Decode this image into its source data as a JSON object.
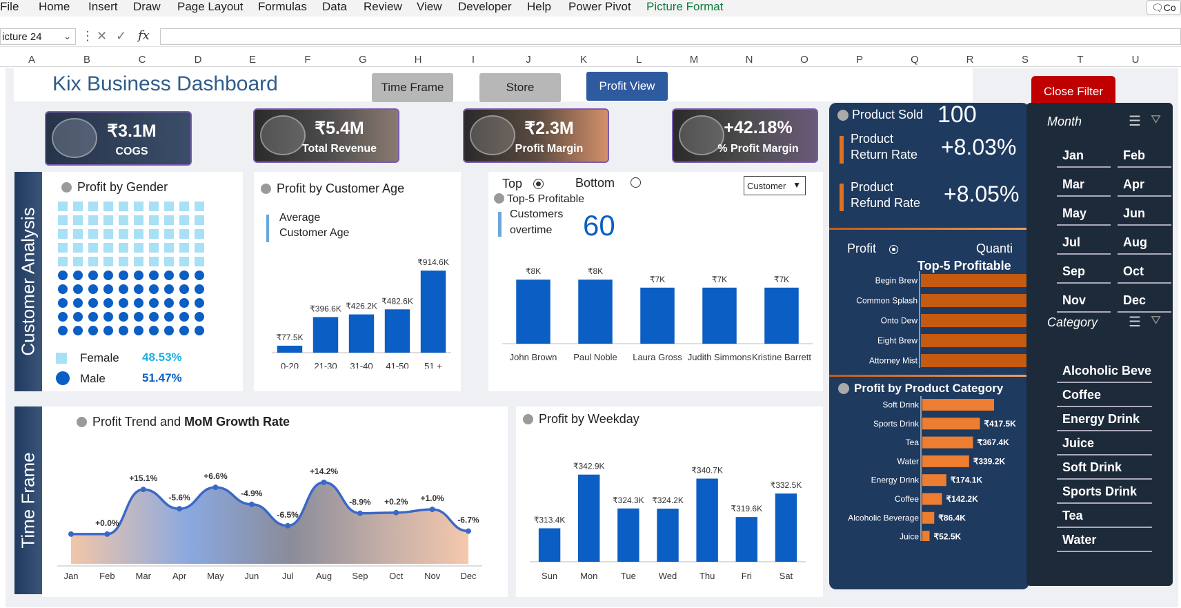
{
  "ribbon": {
    "tabs": [
      "File",
      "Home",
      "Insert",
      "Draw",
      "Page Layout",
      "Formulas",
      "Data",
      "Review",
      "View",
      "Developer",
      "Help",
      "Power Pivot",
      "Picture Format"
    ],
    "active": "Picture Format",
    "comments": "Co"
  },
  "formula_bar": {
    "name_box": "icture 24",
    "fx": "fx"
  },
  "columns": [
    "A",
    "B",
    "C",
    "D",
    "E",
    "F",
    "G",
    "H",
    "I",
    "J",
    "K",
    "L",
    "M",
    "N",
    "O",
    "P",
    "Q",
    "R",
    "S",
    "T",
    "U"
  ],
  "header": {
    "title": "Kix Business Dashboard",
    "buttons": [
      "Time Frame",
      "Store",
      "Profit View"
    ],
    "close": "Close Filter"
  },
  "kpis": [
    {
      "value": "₹3.1M",
      "label": "COGS"
    },
    {
      "value": "₹5.4M",
      "label": "Total Revenue"
    },
    {
      "value": "₹2.3M",
      "label": "Profit Margin"
    },
    {
      "value": "+42.18%",
      "label": "% Profit Margin"
    }
  ],
  "side_labels": {
    "customer": "Customer Analysis",
    "time": "Time Frame"
  },
  "gender": {
    "title": "Profit by Gender",
    "female_label": "Female",
    "female_pct": "48.53%",
    "male_label": "Male",
    "male_pct": "51.47%"
  },
  "age": {
    "title": "Profit by Customer Age",
    "avg_label_1": "Average",
    "avg_label_2": "Customer Age"
  },
  "top5": {
    "top": "Top",
    "bottom": "Bottom",
    "dropdown": "Customer",
    "subtitle": "Top-5 Profitable",
    "cust_label_1": "Customers",
    "cust_label_2": "overtime",
    "cust_value": "60"
  },
  "right": {
    "product_sold_label": "Product Sold",
    "product_sold_value": "100",
    "return_label_1": "Product",
    "return_label_2": "Return Rate",
    "return_value": "+8.03%",
    "refund_label_1": "Product",
    "refund_label_2": "Refund Rate",
    "refund_value": "+8.05%",
    "profit_toggle": "Profit",
    "quantity_toggle": "Quanti",
    "top5_title": "Top-5 Profitable",
    "cat_title": "Profit by Product Category"
  },
  "filters": {
    "month_title": "Month",
    "months": [
      "Jan",
      "Feb",
      "Mar",
      "Apr",
      "May",
      "Jun",
      "Jul",
      "Aug",
      "Sep",
      "Oct",
      "Nov",
      "Dec"
    ],
    "category_title": "Category",
    "categories": [
      "Alcoholic Bever...",
      "Coffee",
      "Energy Drink",
      "Juice",
      "Soft Drink",
      "Sports Drink",
      "Tea",
      "Water"
    ]
  },
  "trend": {
    "title_a": "Profit Trend and ",
    "title_b": "MoM Growth Rate"
  },
  "weekday": {
    "title": "Profit by Weekday"
  },
  "colors": {
    "navy": "#1f3a5f",
    "blue": "#0b5ec4",
    "orange": "#c55a11",
    "lightblue": "#a8e0f5",
    "red": "#c00000"
  },
  "chart_data": [
    {
      "type": "bar",
      "title": "Profit by Customer Age",
      "categories": [
        "0-20",
        "21-30",
        "31-40",
        "41-50",
        "51 +"
      ],
      "values": [
        77.5,
        396.6,
        426.2,
        482.6,
        914.6
      ],
      "labels": [
        "₹77.5K",
        "₹396.6K",
        "₹426.2K",
        "₹482.6K",
        "₹914.6K"
      ],
      "ylim": [
        0,
        1000
      ]
    },
    {
      "type": "bar",
      "title": "Top-5 Profitable",
      "categories": [
        "John Brown",
        "Paul Noble",
        "Laura Gross",
        "Judith Simmons",
        "Kristine Barrett"
      ],
      "values": [
        8,
        8,
        7,
        7,
        7
      ],
      "labels": [
        "₹8K",
        "₹8K",
        "₹7K",
        "₹7K",
        "₹7K"
      ],
      "ylim": [
        0,
        10
      ]
    },
    {
      "type": "area",
      "title": "Profit Trend and MoM Growth Rate",
      "categories": [
        "Jan",
        "Feb",
        "Mar",
        "Apr",
        "May",
        "Jun",
        "Jul",
        "Aug",
        "Sep",
        "Oct",
        "Nov",
        "Dec"
      ],
      "values": [
        100,
        100,
        115,
        108.5,
        115.7,
        110,
        102.8,
        117.4,
        107,
        107.2,
        108.3,
        101
      ],
      "labels": [
        "",
        "+0.0%",
        "+15.1%",
        "-5.6%",
        "+6.6%",
        "-4.9%",
        "-6.5%",
        "+14.2%",
        "-8.9%",
        "+0.2%",
        "+1.0%",
        "-6.7%"
      ]
    },
    {
      "type": "bar",
      "title": "Profit by Weekday",
      "categories": [
        "Sun",
        "Mon",
        "Tue",
        "Wed",
        "Thu",
        "Fri",
        "Sat"
      ],
      "values": [
        313.4,
        342.9,
        324.3,
        324.2,
        340.7,
        319.6,
        332.5
      ],
      "labels": [
        "₹313.4K",
        "₹342.9K",
        "₹324.3K",
        "₹324.2K",
        "₹340.7K",
        "₹319.6K",
        "₹332.5K"
      ],
      "ylim": [
        295,
        350
      ]
    },
    {
      "type": "bar",
      "title": "Top-5 Profitable",
      "orientation": "horizontal",
      "categories": [
        "Begin Brew",
        "Common Splash",
        "Onto Dew",
        "Eight Brew",
        "Attorney Mist"
      ],
      "values": [
        100,
        100,
        100,
        100,
        100
      ]
    },
    {
      "type": "bar",
      "title": "Profit by Product Category",
      "orientation": "horizontal",
      "categories": [
        "Soft Drink",
        "Sports Drink",
        "Tea",
        "Water",
        "Energy Drink",
        "Coffee",
        "Alcoholic Beverage",
        "Juice"
      ],
      "values": [
        520,
        417.5,
        367.4,
        339.2,
        174.1,
        142.2,
        86.4,
        52.5
      ],
      "labels": [
        "",
        "₹417.5K",
        "₹367.4K",
        "₹339.2K",
        "₹174.1K",
        "₹142.2K",
        "₹86.4K",
        "₹52.5K"
      ]
    }
  ]
}
